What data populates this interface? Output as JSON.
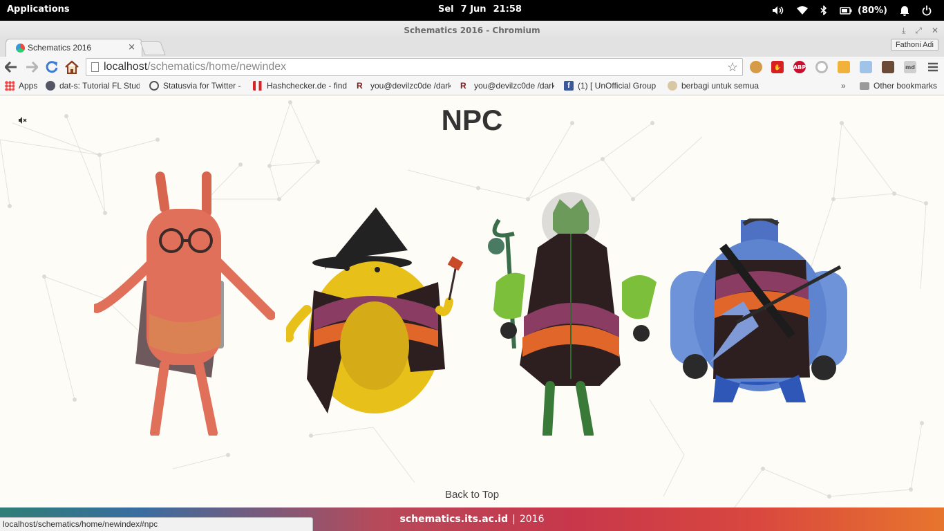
{
  "topbar": {
    "applications": "Applications",
    "day": "Sel",
    "date": "7 Jun",
    "time": "21:58",
    "battery": "(80%)"
  },
  "window": {
    "title": "Schematics 2016 - Chromium",
    "profile": "Fathoni Adi"
  },
  "tab": {
    "title": "Schematics 2016",
    "close": "×"
  },
  "omnibox": {
    "host": "localhost",
    "path": "/schematics/home/newindex"
  },
  "extensions": [
    "cookie-icon",
    "stop-icon",
    "abp-icon",
    "circle-icon",
    "rss-icon",
    "cloud-icon",
    "instagram-icon",
    "md-icon"
  ],
  "bookmarks": {
    "apps": "Apps",
    "items": [
      "dat-s: Tutorial FL Stud",
      "Statusvia for Twitter -",
      "Hashchecker.de - find",
      "you@devilzc0de /dark",
      "you@devilzc0de /dark",
      "(1) [ UnOfficial Group",
      "berbagi untuk semua"
    ],
    "more": "»",
    "other": "Other bookmarks"
  },
  "page": {
    "heading": "NPC",
    "back_to_top": "Back to Top",
    "footer_site": "schematics.its.ac.id",
    "footer_sep": "|",
    "footer_year": "2016"
  },
  "status_url": "localhost/schematics/home/newindex#npc",
  "colors": {
    "page_bg": "#fdfcf6",
    "heading": "#333333",
    "npc_orange": "#e0705a",
    "npc_yellow": "#e8c01a",
    "npc_green": "#5c8f4a",
    "npc_blue": "#5e84d0"
  }
}
